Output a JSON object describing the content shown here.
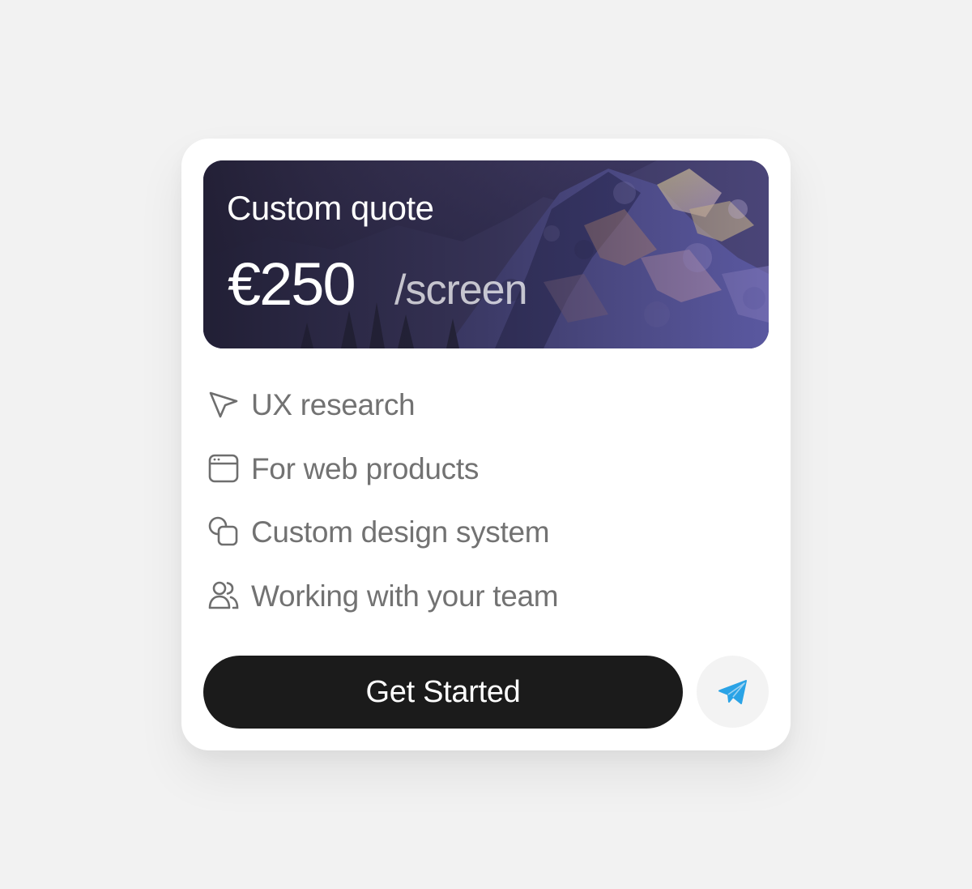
{
  "card": {
    "title": "Custom quote",
    "price": "€250",
    "unit": "/screen",
    "features": [
      {
        "icon": "cursor-arrow-icon",
        "label": "UX research"
      },
      {
        "icon": "browser-window-icon",
        "label": "For web products"
      },
      {
        "icon": "overlapping-shapes-icon",
        "label": "Custom design system"
      },
      {
        "icon": "users-icon",
        "label": "Working with your team"
      }
    ],
    "cta_label": "Get Started",
    "secondary_icon": "telegram-send-icon"
  },
  "colors": {
    "page_bg": "#f2f2f2",
    "card_bg": "#ffffff",
    "cta_bg": "#1b1b1b",
    "feature_text": "#727272",
    "telegram_blue": "#2aa3e6"
  }
}
